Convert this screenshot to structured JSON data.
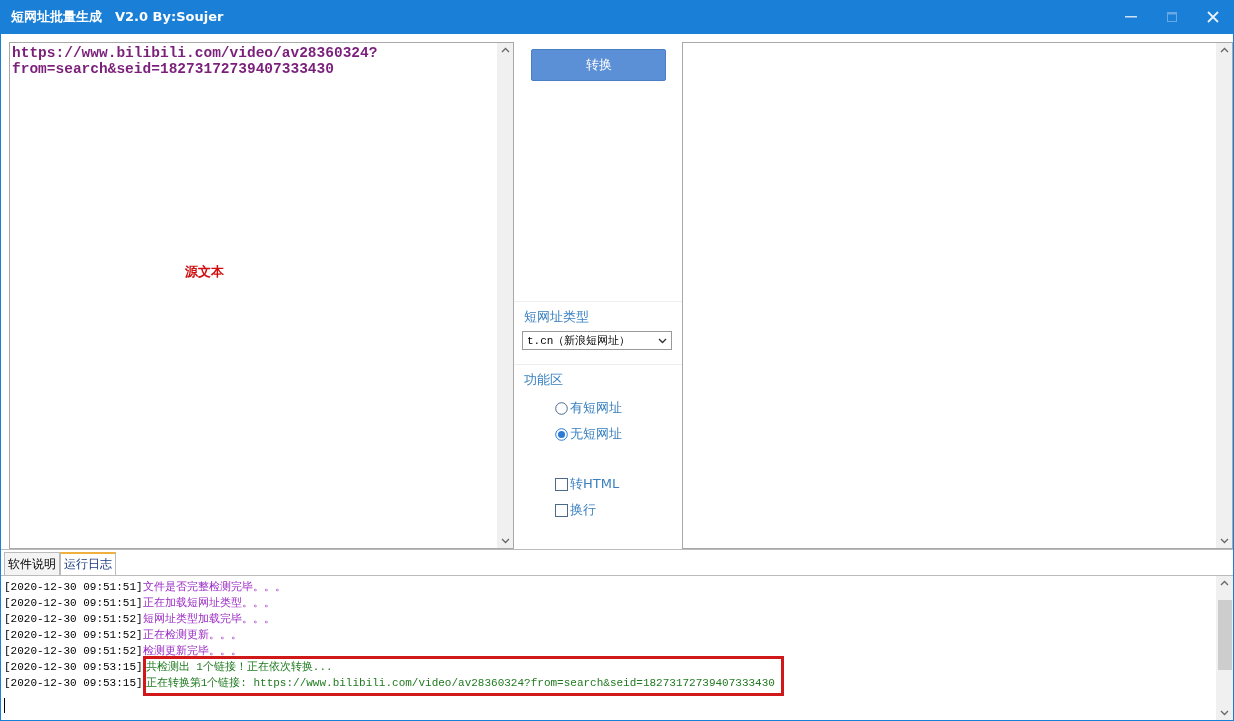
{
  "window": {
    "title": "短网址批量生成　V2.0 By:Soujer"
  },
  "source": {
    "text": "https://www.bilibili.com/video/av28360324?from=search&seid=18273172739407333430",
    "label": "源文本"
  },
  "convert_button": "转换",
  "type_section": {
    "label": "短网址类型",
    "value": "t.cn（新浪短网址）"
  },
  "function_section": {
    "label": "功能区",
    "radios": [
      {
        "label": "有短网址",
        "selected": false
      },
      {
        "label": "无短网址",
        "selected": true
      }
    ],
    "checkboxes": [
      {
        "label": "转HTML",
        "checked": false
      },
      {
        "label": "换行",
        "checked": false
      }
    ]
  },
  "tabs": [
    {
      "label": "软件说明",
      "selected": false
    },
    {
      "label": "运行日志",
      "selected": true
    }
  ],
  "log": [
    {
      "time": "[2020-12-30 09:51:51]",
      "message": "文件是否完整检测完毕。。。",
      "kind": "system",
      "highlighted": false
    },
    {
      "time": "[2020-12-30 09:51:51]",
      "message": "正在加载短网址类型。。。",
      "kind": "system",
      "highlighted": false
    },
    {
      "time": "[2020-12-30 09:51:52]",
      "message": "短网址类型加载完毕。。。",
      "kind": "system",
      "highlighted": false
    },
    {
      "time": "[2020-12-30 09:51:52]",
      "message": "正在检测更新。。。",
      "kind": "system",
      "highlighted": false
    },
    {
      "time": "[2020-12-30 09:51:52]",
      "message": "检测更新完毕。。。",
      "kind": "system",
      "highlighted": false
    },
    {
      "time": "[2020-12-30 09:53:15]",
      "message": "共检测出 1个链接！正在依次转换...",
      "kind": "convert",
      "highlighted": true
    },
    {
      "time": "[2020-12-30 09:53:15]",
      "message": "正在转换第1个链接: https://www.bilibili.com/video/av28360324?from=search&seid=18273172739407333430",
      "kind": "convert",
      "highlighted": true
    }
  ]
}
